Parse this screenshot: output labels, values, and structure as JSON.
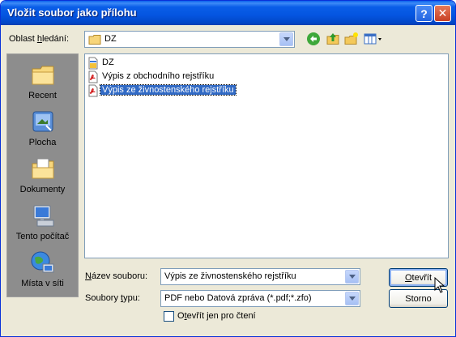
{
  "window": {
    "title": "Vložit soubor jako přílohu",
    "help_glyph": "?",
    "close_glyph": "✕"
  },
  "lookin": {
    "label_prefix": "Oblast ",
    "label_accel": "h",
    "label_suffix": "ledání:",
    "value": "DZ"
  },
  "toolbar": {
    "icons": [
      "back-icon",
      "up-folder-icon",
      "new-folder-icon",
      "view-menu-icon"
    ]
  },
  "places": [
    {
      "label": "Recent",
      "icon": "recent-folder-icon"
    },
    {
      "label": "Plocha",
      "icon": "desktop-icon"
    },
    {
      "label": "Dokumenty",
      "icon": "documents-folder-icon"
    },
    {
      "label": "Tento počítač",
      "icon": "computer-icon"
    },
    {
      "label": "Místa v síti",
      "icon": "network-icon"
    }
  ],
  "files": [
    {
      "name": "DZ",
      "icon": "dz-file-icon",
      "selected": false
    },
    {
      "name": "Výpis z obchodního rejstříku",
      "icon": "pdf-file-icon",
      "selected": false
    },
    {
      "name": "Výpis ze živnostenského rejstříku",
      "icon": "pdf-file-icon",
      "selected": true
    }
  ],
  "filename": {
    "label_accel": "N",
    "label_suffix": "ázev souboru:",
    "value": "Výpis ze živnostenského rejstříku"
  },
  "filetype": {
    "label_prefix": "Soubory ",
    "label_accel": "t",
    "label_suffix": "ypu:",
    "value": "PDF nebo  Datová zpráva (*.pdf;*.zfo)"
  },
  "buttons": {
    "open_accel": "O",
    "open_rest": "tevřít",
    "cancel": "Storno"
  },
  "readonly": {
    "label_prefix": "O",
    "label_accel": "t",
    "label_suffix": "evřít jen pro čtení",
    "checked": false
  },
  "colors": {
    "title_bar": "#0a5ee8",
    "dialog_bg": "#ece9d8",
    "places_bg": "#8d8d8d",
    "selection": "#316ac5"
  }
}
